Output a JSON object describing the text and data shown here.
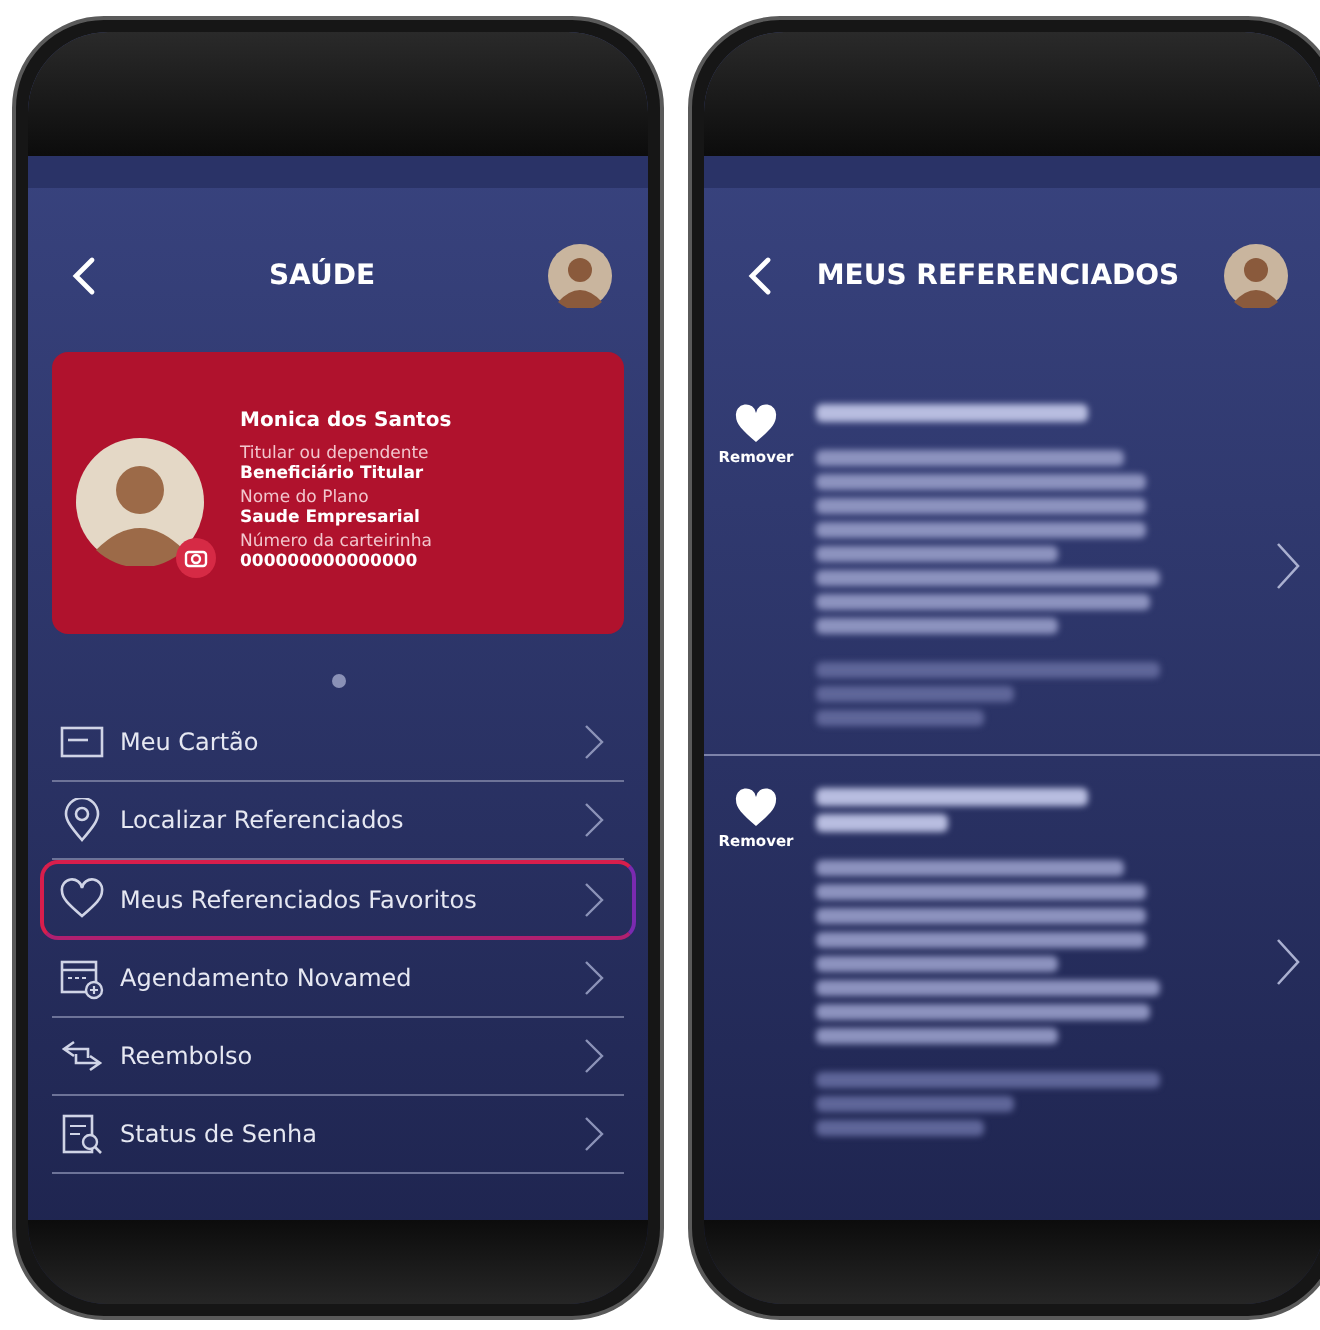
{
  "screens": [
    {
      "kind": "home",
      "title": "SAÚDE",
      "card": {
        "name": "Monica dos Santos",
        "fields": [
          {
            "label": "Titular ou dependente",
            "value": "Beneficiário Titular"
          },
          {
            "label": "Nome do Plano",
            "value": "Saude Empresarial"
          },
          {
            "label": "Número da carteirinha",
            "value": "000000000000000"
          }
        ]
      },
      "menu": [
        {
          "kind": "card",
          "label": "Meu Cartão",
          "highlighted": false
        },
        {
          "kind": "pin",
          "label": "Localizar Referenciados",
          "highlighted": false
        },
        {
          "kind": "heart",
          "label": "Meus Referenciados Favoritos",
          "highlighted": true
        },
        {
          "kind": "calendar",
          "label": "Agendamento Novamed",
          "highlighted": false
        },
        {
          "kind": "arrows",
          "label": "Reembolso",
          "highlighted": false
        },
        {
          "kind": "document",
          "label": "Status de Senha",
          "highlighted": false
        }
      ]
    },
    {
      "kind": "favorites",
      "title": "MEUS REFERENCIADOS",
      "items": [
        {
          "action": "Remover"
        },
        {
          "action": "Remover"
        }
      ]
    }
  ]
}
